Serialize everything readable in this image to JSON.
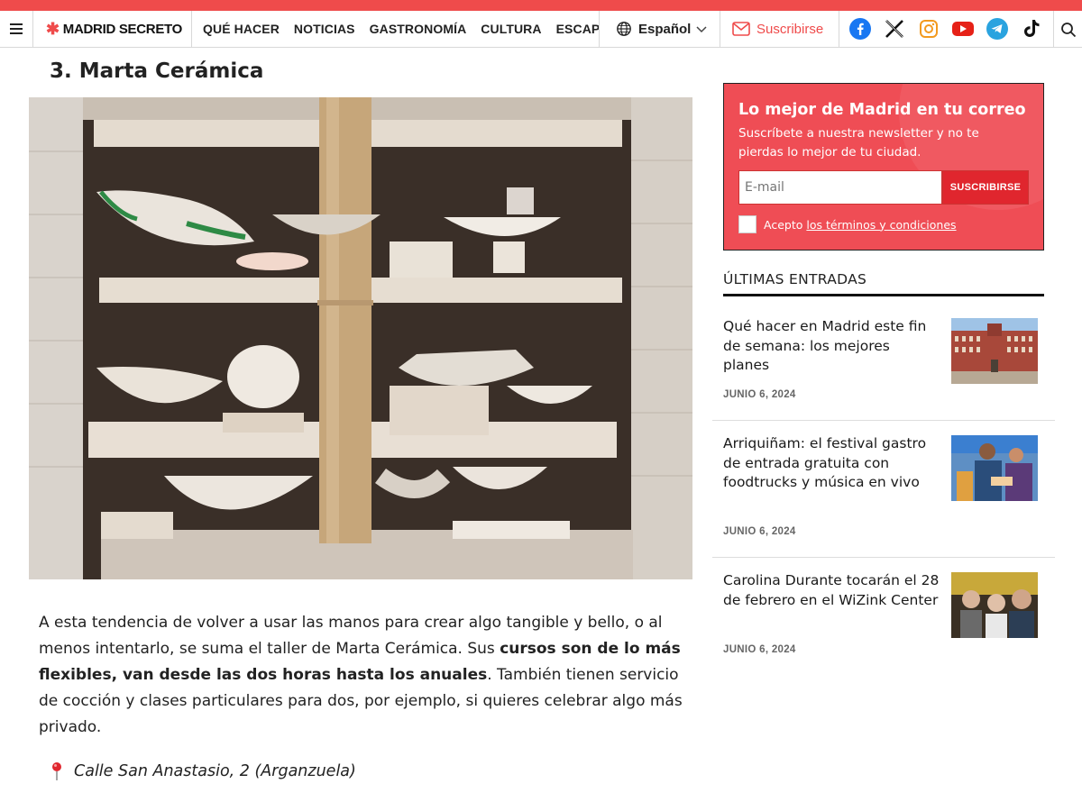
{
  "header": {
    "logo": "MADRID SECRETO",
    "nav": [
      "QUÉ HACER",
      "NOTICIAS",
      "GASTRONOMÍA",
      "CULTURA",
      "ESCAPA"
    ],
    "language": "Español",
    "subscribe": "Suscribirse",
    "socials": [
      "facebook-icon",
      "x-icon",
      "instagram-icon",
      "youtube-icon",
      "telegram-icon",
      "tiktok-icon"
    ]
  },
  "article": {
    "title": "3. Marta Cerámica",
    "paragraph": {
      "before": "A esta tendencia de volver a usar las manos para crear algo tangible y bello, o al menos intentarlo, se suma el taller de Marta Cerámica. Sus ",
      "bold": "cursos son de lo más flexibles, van desde las dos horas hasta los anuales",
      "after": ". También tienen servicio de cocción y clases particulares para dos, por ejemplo, si quieres celebrar algo más privado."
    },
    "address": "Calle San Anastasio, 2 (Arganzuela)"
  },
  "newsletter": {
    "title": "Lo mejor de Madrid en tu correo",
    "text": "Suscríbete a nuestra newsletter y no te pierdas lo mejor de tu ciudad.",
    "email_placeholder": "E-mail",
    "button": "SUSCRIBIRSE",
    "terms_prefix": "Acepto",
    "terms_link": "los términos y condiciones"
  },
  "latest": {
    "title": "ÚLTIMAS ENTRADAS",
    "posts": [
      {
        "title": "Qué hacer en Madrid este fin de semana: los mejores planes",
        "date": "JUNIO 6, 2024"
      },
      {
        "title": "Arriquiñam: el festival gastro de entrada gratuita con foodtrucks y música en vivo",
        "date": "JUNIO 6, 2024"
      },
      {
        "title": "Carolina Durante tocarán el 28 de febrero en el WiZink Center",
        "date": "JUNIO 6, 2024"
      }
    ]
  },
  "colors": {
    "accent": "#ef4b4b",
    "newsletter_bg": "#ef4d55",
    "button": "#e0262e"
  }
}
